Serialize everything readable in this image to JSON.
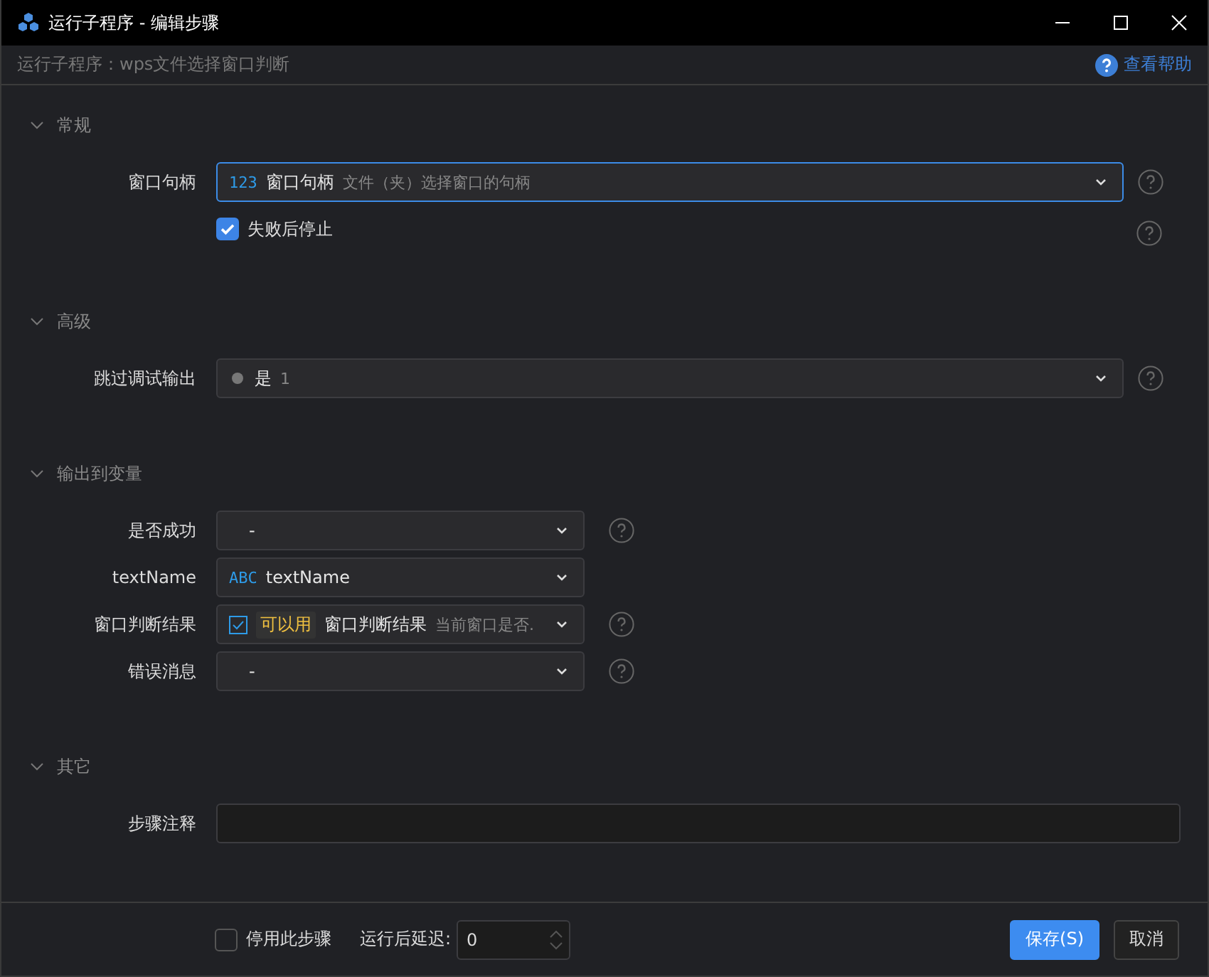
{
  "window": {
    "title": "运行子程序 - 编辑步骤"
  },
  "subtitle": "运行子程序：wps文件选择窗口判断",
  "help_link": "查看帮助",
  "sections": [
    {
      "title": "常规",
      "expanded": true,
      "kind": "wide",
      "rows": [
        {
          "kind": "field",
          "label": "窗口句柄",
          "help": true,
          "field": {
            "kind": "typed",
            "focused": true,
            "type_label": "123",
            "value": "窗口句柄",
            "hint": "文件（夹）选择窗口的句柄"
          }
        },
        {
          "kind": "checkbox",
          "label": "失败后停止",
          "checked": true,
          "help": true
        }
      ]
    },
    {
      "title": "高级",
      "expanded": true,
      "kind": "wide",
      "rows": [
        {
          "kind": "field",
          "label": "跳过调试输出",
          "help": true,
          "field": {
            "kind": "bool",
            "focused": false,
            "value": "是",
            "hint": "1"
          }
        }
      ]
    },
    {
      "title": "输出到变量",
      "expanded": true,
      "kind": "narrow",
      "rows": [
        {
          "kind": "field",
          "label": "是否成功",
          "help": true,
          "field": {
            "kind": "plain",
            "focused": false,
            "value": "-"
          }
        },
        {
          "kind": "field",
          "label": "textName",
          "help": false,
          "field": {
            "kind": "typed",
            "focused": false,
            "type_label": "ABC",
            "value": "textName"
          }
        },
        {
          "kind": "field",
          "label": "窗口判断结果",
          "help": true,
          "field": {
            "kind": "check",
            "focused": false,
            "tag": "可以用",
            "value": "窗口判断结果",
            "hint": "当前窗口是否."
          }
        },
        {
          "kind": "field",
          "label": "错误消息",
          "help": true,
          "field": {
            "kind": "plain",
            "focused": false,
            "value": "-"
          }
        }
      ]
    },
    {
      "title": "其它",
      "expanded": true,
      "kind": "wide",
      "rows": [
        {
          "kind": "field",
          "label": "步骤注释",
          "help": false,
          "field": {
            "kind": "text",
            "focused": false
          }
        }
      ]
    }
  ],
  "footer": {
    "disable": {
      "label": "停用此步骤",
      "checked": false
    },
    "delay_label": "运行后延迟:",
    "delay_value": "0",
    "buttons": [
      {
        "label": "保存(S)",
        "kind": "primary"
      },
      {
        "label": "取消",
        "kind": "secondary"
      }
    ]
  }
}
